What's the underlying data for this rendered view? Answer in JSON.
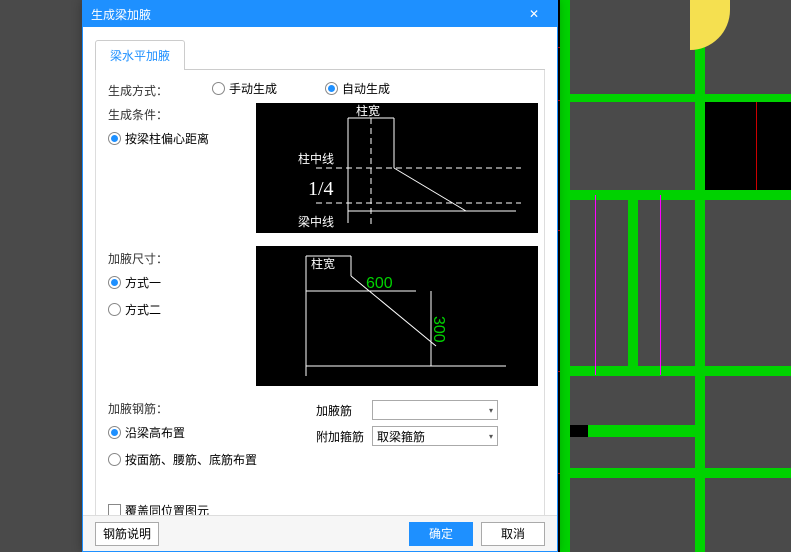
{
  "dialog": {
    "title": "生成梁加腋",
    "tab": "梁水平加腋",
    "gen_method_label": "生成方式：",
    "gen_method": {
      "manual": "手动生成",
      "auto": "自动生成",
      "selected": "auto"
    },
    "gen_cond_label": "生成条件：",
    "gen_cond": {
      "byOffset": "按梁柱偏心距离",
      "selected": "byOffset"
    },
    "diag1": {
      "col_width": "柱宽",
      "col_center": "柱中线",
      "beam_center": "梁中线",
      "fraction": "1/4"
    },
    "size_label": "加腋尺寸：",
    "size": {
      "opt1": "方式一",
      "opt2": "方式二",
      "selected": "opt1"
    },
    "diag2": {
      "col_width": "柱宽",
      "v600": "600",
      "v300": "300"
    },
    "rebar_label": "加腋钢筋：",
    "rebar_layout": {
      "opt1": "沿梁高布置",
      "opt2": "按面筋、腰筋、底筋布置",
      "selected": "opt1"
    },
    "combo1_label": "加腋筋",
    "combo1_value": "",
    "combo2_label": "附加箍筋",
    "combo2_value": "取梁箍筋",
    "overwrite": "覆盖同位置图元",
    "btn_help": "钢筋说明",
    "btn_ok": "确定",
    "btn_cancel": "取消"
  }
}
